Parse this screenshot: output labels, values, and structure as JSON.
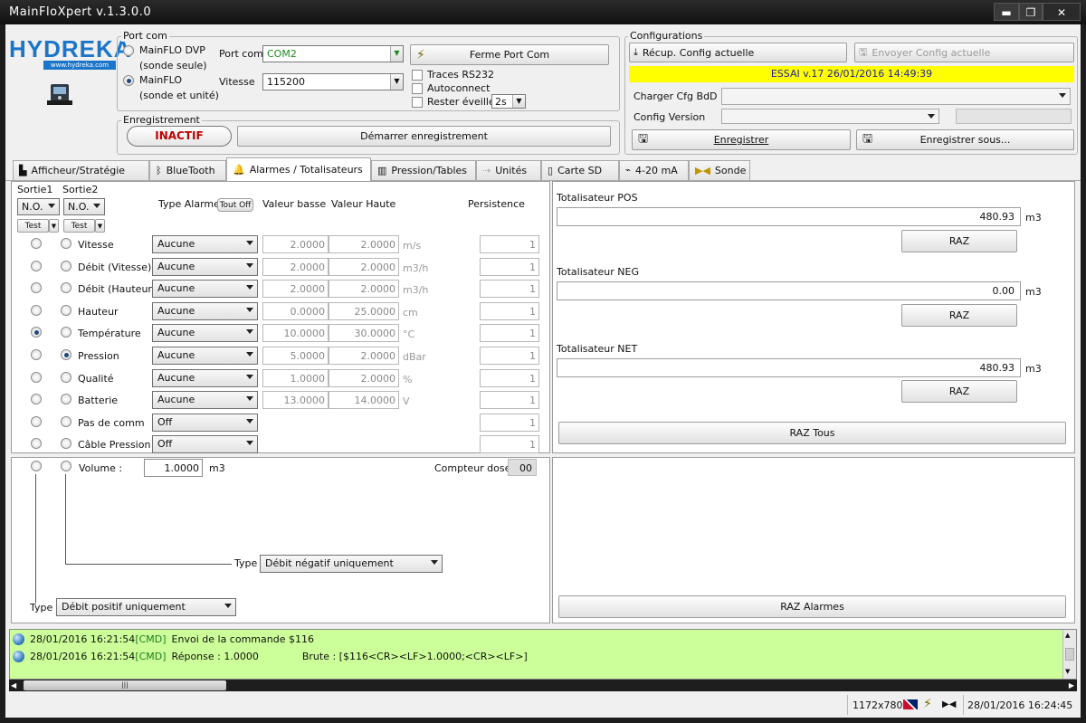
{
  "window": {
    "title": "MainFloXpert v.1.3.0.0",
    "min_icon": "minimize-icon",
    "max_icon": "maximize-icon",
    "close_icon": "close-icon"
  },
  "logo": {
    "brand": "HYDREKA",
    "url": "www.hydreka.com"
  },
  "portcom": {
    "group": "Port com",
    "opt1": "MainFLO DVP",
    "opt1b": "(sonde seule)",
    "opt2": "MainFLO",
    "opt2b": "(sonde et unité)",
    "port_label": "Port com",
    "port_value": "COM2",
    "speed_label": "Vitesse",
    "speed_value": "115200",
    "close_button": "Ferme Port Com",
    "traces": "Traces RS232",
    "autoconnect": "Autoconnect",
    "stay_awake": "Rester éveillé",
    "stay_awake_value": "2s"
  },
  "recording": {
    "group": "Enregistrement",
    "status": "INACTIF",
    "start_button": "Démarrer enregistrement"
  },
  "config": {
    "group": "Configurations",
    "get_button": "Récup. Config actuelle",
    "send_button": "Envoyer Config actuelle",
    "banner": "ESSAI v.17   26/01/2016   14:49:39",
    "load_label": "Charger Cfg BdD",
    "version_label": "Config Version",
    "save_button": "Enregistrer",
    "save_as_button": "Enregistrer sous..."
  },
  "tabs": [
    "Afficheur/Stratégie",
    "BlueTooth",
    "Alarmes / Totalisateurs",
    "Pression/Tables",
    "Unités",
    "Carte SD",
    "4-20 mA",
    "Sonde"
  ],
  "alarms": {
    "sortie1": "Sortie1",
    "sortie2": "Sortie2",
    "no1": "N.O.",
    "no2": "N.O.",
    "test1": "Test",
    "test2": "Test",
    "type_header": "Type Alarme",
    "tout_off": "Tout Off",
    "low_header": "Valeur basse",
    "high_header": "Valeur Haute",
    "persist_header": "Persistence",
    "rows": [
      {
        "name": "Vitesse",
        "type": "Aucune",
        "low": "2.0000",
        "high": "2.0000",
        "unit": "m/s",
        "persist": "1"
      },
      {
        "name": "Débit (Vitesse)",
        "type": "Aucune",
        "low": "2.0000",
        "high": "2.0000",
        "unit": "m3/h",
        "persist": "1"
      },
      {
        "name": "Débit (Hauteur)",
        "type": "Aucune",
        "low": "2.0000",
        "high": "2.0000",
        "unit": "m3/h",
        "persist": "1"
      },
      {
        "name": "Hauteur",
        "type": "Aucune",
        "low": "0.0000",
        "high": "25.0000",
        "unit": "cm",
        "persist": "1"
      },
      {
        "name": "Température",
        "type": "Aucune",
        "low": "10.0000",
        "high": "30.0000",
        "unit": "°C",
        "persist": "1"
      },
      {
        "name": "Pression",
        "type": "Aucune",
        "low": "5.0000",
        "high": "2.0000",
        "unit": "dBar",
        "persist": "1"
      },
      {
        "name": "Qualité",
        "type": "Aucune",
        "low": "1.0000",
        "high": "2.0000",
        "unit": "%",
        "persist": "1"
      },
      {
        "name": "Batterie",
        "type": "Aucune",
        "low": "13.0000",
        "high": "14.0000",
        "unit": "V",
        "persist": "1"
      },
      {
        "name": "Pas de comm",
        "type": "Off",
        "low": "",
        "high": "",
        "unit": "",
        "persist": "1"
      },
      {
        "name": "Câble Pression",
        "type": "Off",
        "low": "",
        "high": "",
        "unit": "",
        "persist": "1"
      }
    ]
  },
  "volume": {
    "label": "Volume  :",
    "value": "1.0000",
    "unit": "m3",
    "counter_label": "Compteur dose",
    "counter_value": "00",
    "type_label": "Type",
    "type2_value": "Débit négatif uniquement",
    "type1_value": "Débit positif uniquement"
  },
  "totals": {
    "pos_label": "Totalisateur POS",
    "pos_value": "480.93",
    "neg_label": "Totalisateur NEG",
    "neg_value": "0.00",
    "net_label": "Totalisateur NET",
    "net_value": "480.93",
    "unit": "m3",
    "raz": "RAZ",
    "raz_all": "RAZ Tous",
    "raz_alarms": "RAZ Alarmes"
  },
  "log": [
    {
      "ts": "28/01/2016 16:21:54",
      "tag": "[CMD]",
      "msg": "Envoi de la commande $116",
      "raw": ""
    },
    {
      "ts": "28/01/2016 16:21:54",
      "tag": "[CMD]",
      "msg": "Réponse : 1.0000",
      "raw": "Brute : [$116<CR><LF>1.0000;<CR><LF>]"
    }
  ],
  "status": {
    "resolution": "1172x780",
    "datetime": "28/01/2016  16:24:45"
  },
  "colors": {
    "banner": "#ffff00",
    "log_bg": "#ccff99",
    "tag": "#1e7a1e",
    "status_inactive": "#c00000"
  }
}
